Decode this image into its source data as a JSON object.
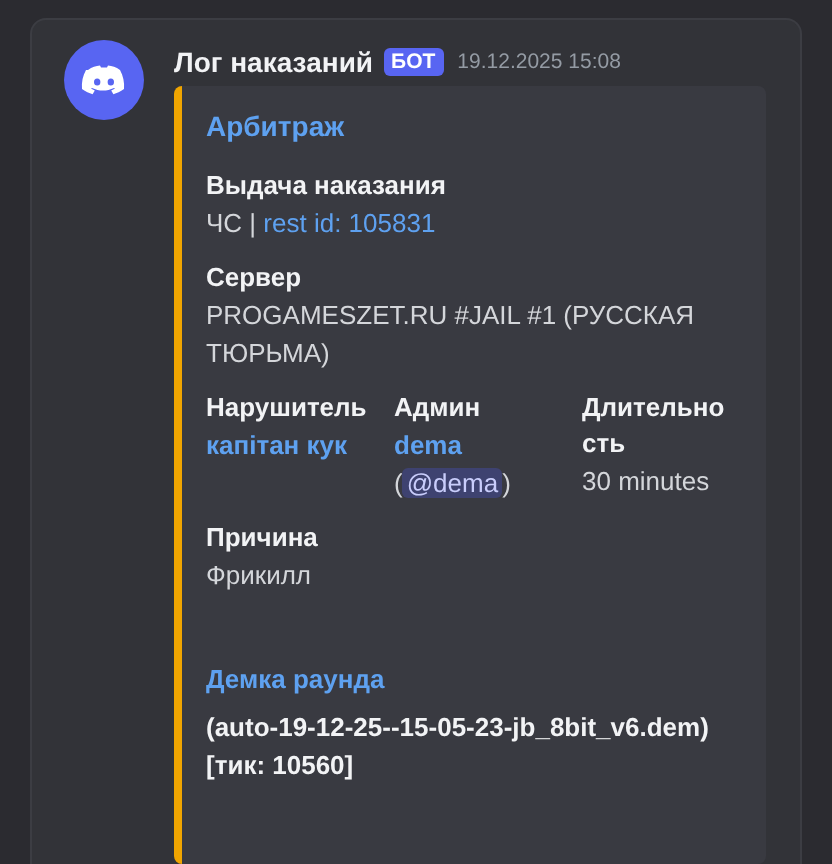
{
  "message": {
    "author": "Лог наказаний",
    "badge": "БОТ",
    "timestamp": "19.12.2025 15:08"
  },
  "embed": {
    "title": "Арбитраж",
    "fields": [
      {
        "name": "Выдача наказания",
        "inline": false,
        "value": [
          {
            "kind": "text",
            "text": "ЧС |"
          },
          {
            "kind": "link",
            "text": "rest id: 105831"
          }
        ]
      },
      {
        "name": "Сервер",
        "inline": false,
        "value": [
          {
            "kind": "text",
            "text": "PROGAMESZET.RU #JAIL #1 (РУССКАЯ ТЮРЬМА)"
          }
        ]
      },
      {
        "name": "Нарушитель",
        "inline": true,
        "value": [
          {
            "kind": "boldlink",
            "text": "капітан кук"
          }
        ]
      },
      {
        "name": "Админ",
        "inline": true,
        "value": [
          {
            "kind": "boldlink",
            "text": "dema"
          },
          {
            "kind": "text",
            "text": "("
          },
          {
            "kind": "mention",
            "text": "@dema"
          },
          {
            "kind": "text",
            "text": ")"
          }
        ]
      },
      {
        "name": "Длительность",
        "inline": true,
        "value": [
          {
            "kind": "text",
            "text": "30 minutes"
          }
        ]
      },
      {
        "name": "Причина",
        "inline": false,
        "value": [
          {
            "kind": "text",
            "text": "Фрикилл"
          }
        ]
      }
    ],
    "demo": {
      "title": "Демка раунда",
      "value": "(auto-19-12-25--15-05-23-jb_8bit_v6.dem) [тик: 10560]"
    }
  }
}
